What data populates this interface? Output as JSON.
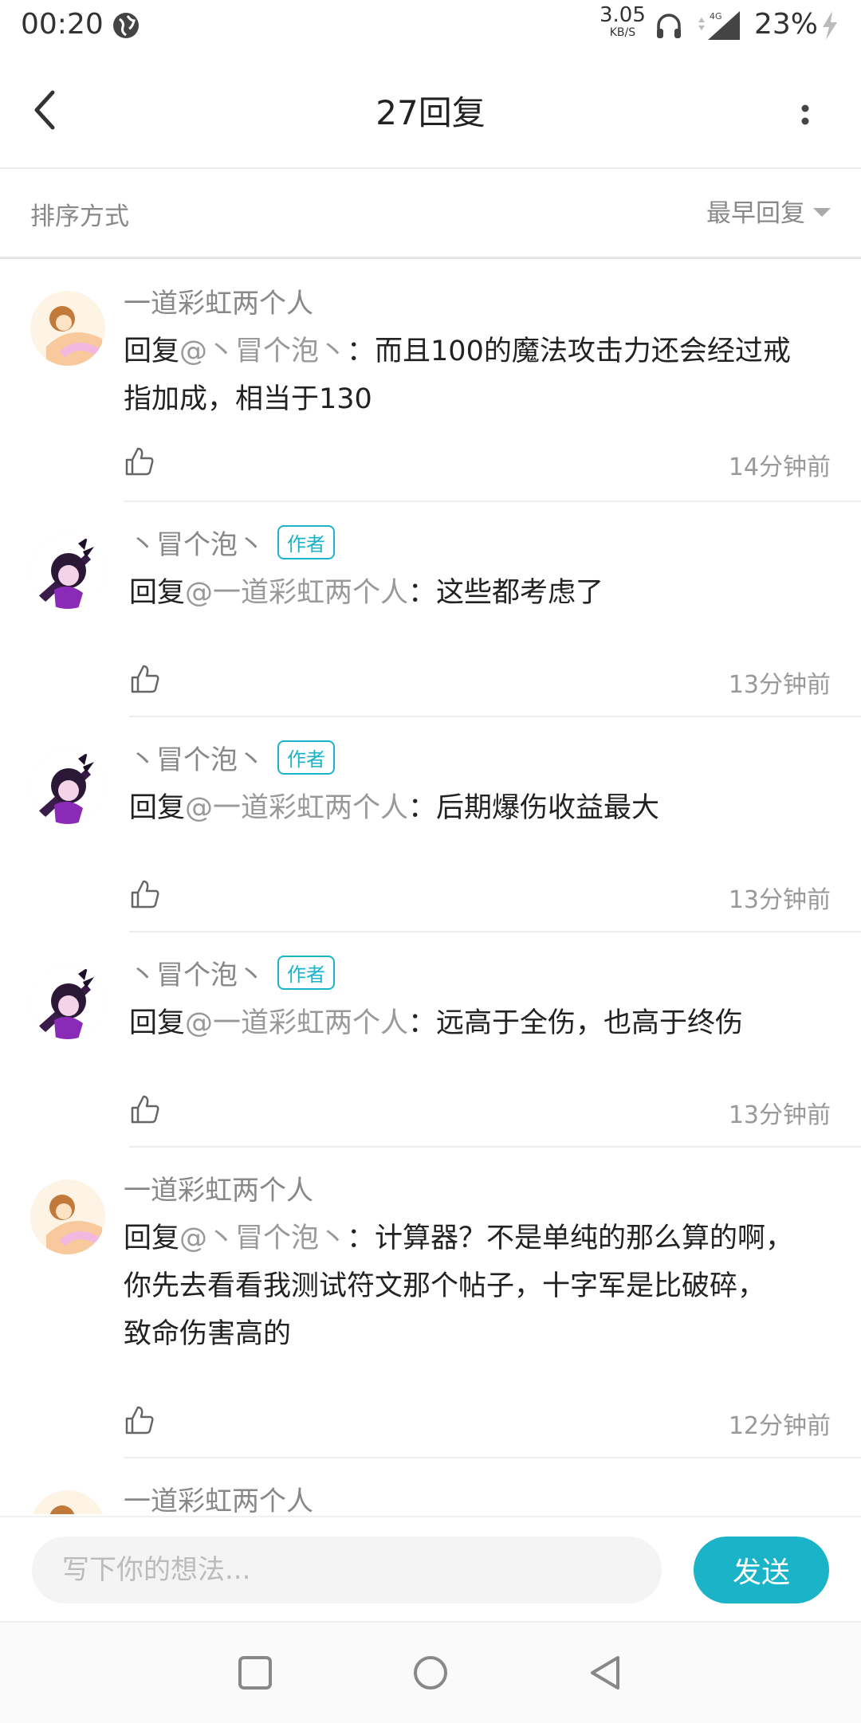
{
  "status_bar": {
    "time": "00:20",
    "net_speed": "3.05",
    "net_unit": "KB/S",
    "battery": "23%"
  },
  "header": {
    "title": "27回复"
  },
  "sort": {
    "label": "排序方式",
    "value": "最早回复"
  },
  "comments": [
    {
      "name": "一道彩虹两个人",
      "is_author": false,
      "badge": "",
      "reply_prefix": "回复",
      "reply_to": "@丶冒个泡丶",
      "line1": "：而且100的魔法攻击力还会经过戒",
      "line2": "指加成，相当于130",
      "line3": "",
      "time": "14分钟前"
    },
    {
      "name": "丶冒个泡丶",
      "is_author": true,
      "badge": "作者",
      "reply_prefix": "回复",
      "reply_to": "@一道彩虹两个人",
      "line1": "：这些都考虑了",
      "line2": "",
      "line3": "",
      "time": "13分钟前"
    },
    {
      "name": "丶冒个泡丶",
      "is_author": true,
      "badge": "作者",
      "reply_prefix": "回复",
      "reply_to": "@一道彩虹两个人",
      "line1": "：后期爆伤收益最大",
      "line2": "",
      "line3": "",
      "time": "13分钟前"
    },
    {
      "name": "丶冒个泡丶",
      "is_author": true,
      "badge": "作者",
      "reply_prefix": "回复",
      "reply_to": "@一道彩虹两个人",
      "line1": "：远高于全伤，也高于终伤",
      "line2": "",
      "line3": "",
      "time": "13分钟前"
    },
    {
      "name": "一道彩虹两个人",
      "is_author": false,
      "badge": "",
      "reply_prefix": "回复",
      "reply_to": "@丶冒个泡丶",
      "line1": "：计算器？不是单纯的那么算的啊，",
      "line2": "你先去看看我测试符文那个帖子，十字军是比破碎，",
      "line3": "致命伤害高的",
      "time": "12分钟前"
    },
    {
      "name": "一道彩虹两个人",
      "is_author": false,
      "badge": "",
      "reply_prefix": "",
      "reply_to": "",
      "line1": "",
      "line2": "",
      "line3": "",
      "time": ""
    }
  ],
  "composer": {
    "placeholder": "写下你的想法...",
    "send_label": "发送"
  },
  "colors": {
    "accent": "#1bb3c7",
    "muted_text": "#888888"
  },
  "icons": {
    "back": "chevron-left-icon",
    "more": "more-vertical-icon",
    "like": "thumbs-up-icon"
  }
}
